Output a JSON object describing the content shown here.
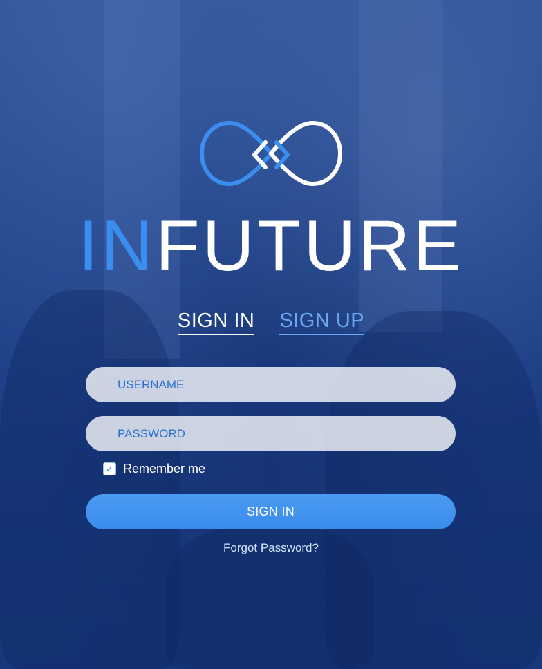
{
  "brand": {
    "prefix": "IN",
    "suffix": "FUTURE",
    "accent_color": "#3b8ef0",
    "logo_icon": "infinity-code-icon"
  },
  "tabs": [
    {
      "label": "SIGN IN",
      "active": true
    },
    {
      "label": "SIGN UP",
      "active": false
    }
  ],
  "form": {
    "username_placeholder": "USERNAME",
    "username_value": "",
    "password_placeholder": "PASSWORD",
    "password_value": "",
    "remember_label": "Remember me",
    "remember_checked": true,
    "submit_label": "SIGN IN",
    "forgot_label": "Forgot Password?"
  },
  "colors": {
    "background": "#1f4283",
    "button": "#3a8cec",
    "inactive_tab": "#6aa8f2"
  }
}
